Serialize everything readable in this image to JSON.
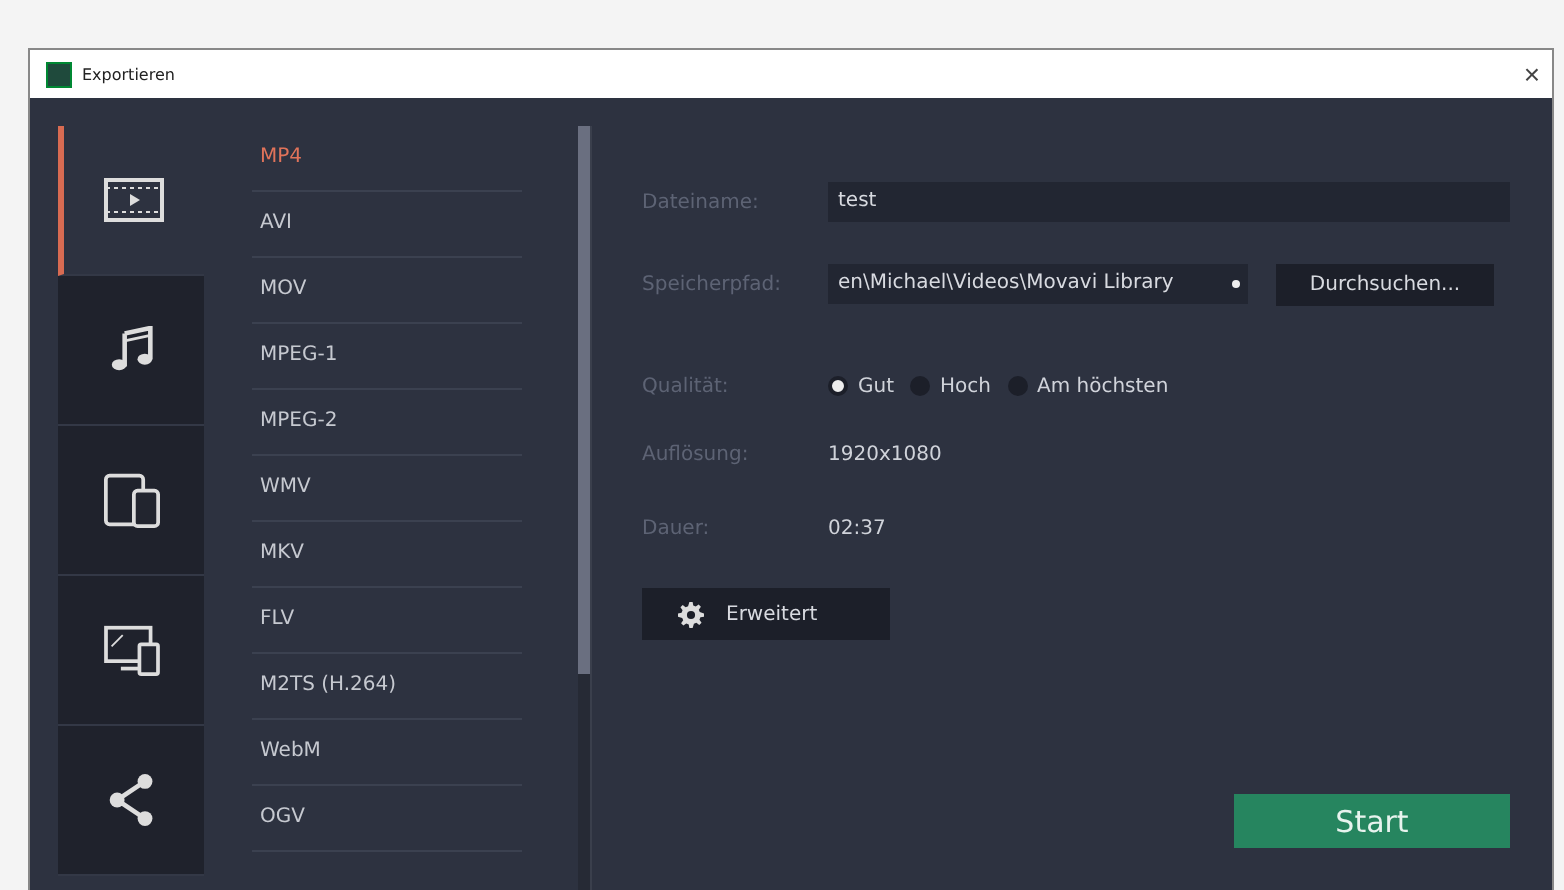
{
  "window": {
    "title": "Exportieren",
    "close": "×"
  },
  "categories": [
    {
      "kind": "video",
      "selected": true
    },
    {
      "kind": "audio",
      "selected": false
    },
    {
      "kind": "devices",
      "selected": false
    },
    {
      "kind": "tv",
      "selected": false
    },
    {
      "kind": "share",
      "selected": false
    }
  ],
  "formats": [
    {
      "label": "MP4",
      "selected": true
    },
    {
      "label": "AVI",
      "selected": false
    },
    {
      "label": "MOV",
      "selected": false
    },
    {
      "label": "MPEG-1",
      "selected": false
    },
    {
      "label": "MPEG-2",
      "selected": false
    },
    {
      "label": "WMV",
      "selected": false
    },
    {
      "label": "MKV",
      "selected": false
    },
    {
      "label": "FLV",
      "selected": false
    },
    {
      "label": "M2TS (H.264)",
      "selected": false
    },
    {
      "label": "WebM",
      "selected": false
    },
    {
      "label": "OGV",
      "selected": false
    }
  ],
  "settings": {
    "filename_label": "Dateiname:",
    "filename": "test",
    "path_label": "Speicherpfad:",
    "path": "en\\Michael\\Videos\\Movavi Library",
    "browse": "Durchsuchen...",
    "quality_label": "Qualität:",
    "quality": [
      {
        "label": "Gut",
        "selected": true
      },
      {
        "label": "Hoch",
        "selected": false
      },
      {
        "label": "Am höchsten",
        "selected": false
      }
    ],
    "resolution_label": "Auflösung:",
    "resolution": "1920x1080",
    "duration_label": "Dauer:",
    "duration": "02:37",
    "advanced": "Erweitert"
  },
  "start": "Start"
}
